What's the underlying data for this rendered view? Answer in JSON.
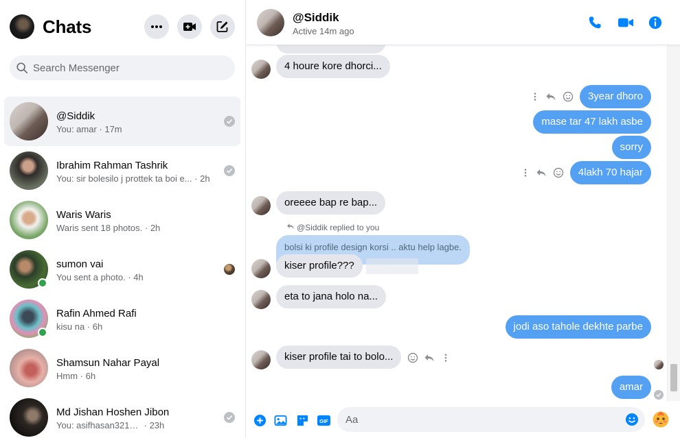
{
  "sidebar": {
    "title": "Chats",
    "search_placeholder": "Search Messenger",
    "chats": [
      {
        "name": "@Siddik",
        "preview": "You: amar",
        "time": "17m",
        "active": true,
        "online": false,
        "status": "sent"
      },
      {
        "name": "Ibrahim Rahman Tashrik",
        "preview": "You: sir bolesilo j prottek ta boi e...",
        "time": "2h",
        "active": false,
        "online": false,
        "status": "sent"
      },
      {
        "name": "Waris Waris",
        "preview": "Waris sent 18 photos.",
        "time": "2h",
        "active": false,
        "online": false,
        "status": "none"
      },
      {
        "name": "sumon vai",
        "preview": "You sent a photo.",
        "time": "4h",
        "active": false,
        "online": true,
        "status": "seen"
      },
      {
        "name": "Rafin Ahmed Rafi",
        "preview": "kisu na",
        "time": "6h",
        "active": false,
        "online": true,
        "status": "none"
      },
      {
        "name": "Shamsun Nahar Payal",
        "preview": "Hmm",
        "time": "6h",
        "active": false,
        "online": false,
        "status": "none"
      },
      {
        "name": "Md Jishan Hoshen Jibon",
        "preview": "You: asifhasan3210...",
        "time": "23h",
        "active": false,
        "online": false,
        "status": "sent"
      }
    ]
  },
  "conversation": {
    "name": "@Siddik",
    "status": "Active 14m ago",
    "messages": [
      {
        "dir": "in",
        "text": "4 houre kore dhorci..."
      },
      {
        "dir": "out",
        "text": "3year dhoro"
      },
      {
        "dir": "out",
        "text": "mase tar 47 lakh asbe"
      },
      {
        "dir": "out",
        "text": "sorry"
      },
      {
        "dir": "out",
        "text": "4lakh 70 hajar"
      },
      {
        "dir": "in",
        "text": "oreeee bap re bap..."
      },
      {
        "dir": "in",
        "text": "kiser profile???"
      },
      {
        "dir": "in",
        "text": "eta to jana holo na..."
      },
      {
        "dir": "out",
        "text": "jodi aso tahole dekhte parbe"
      },
      {
        "dir": "in",
        "text": "kiser profile tai to bolo..."
      },
      {
        "dir": "out",
        "text": "amar"
      }
    ],
    "reply_note": "@Siddik replied to you",
    "quoted_text": "bolsi ki profile design korsi .. aktu help lagbe."
  },
  "composer": {
    "placeholder": "Aa"
  },
  "colors": {
    "accent": "#0084ff",
    "outgoing_bubble": "#54a0f3",
    "incoming_bubble": "#e4e6eb",
    "online": "#31a24c"
  },
  "icons": [
    "more-icon",
    "new-video-call-icon",
    "compose-icon",
    "search-icon",
    "phone-icon",
    "video-call-icon",
    "info-icon",
    "plus-icon",
    "image-icon",
    "sticker-icon",
    "gif-icon",
    "emoji-icon",
    "reaction-emoji-icon",
    "reply-icon",
    "more-vertical-icon"
  ]
}
